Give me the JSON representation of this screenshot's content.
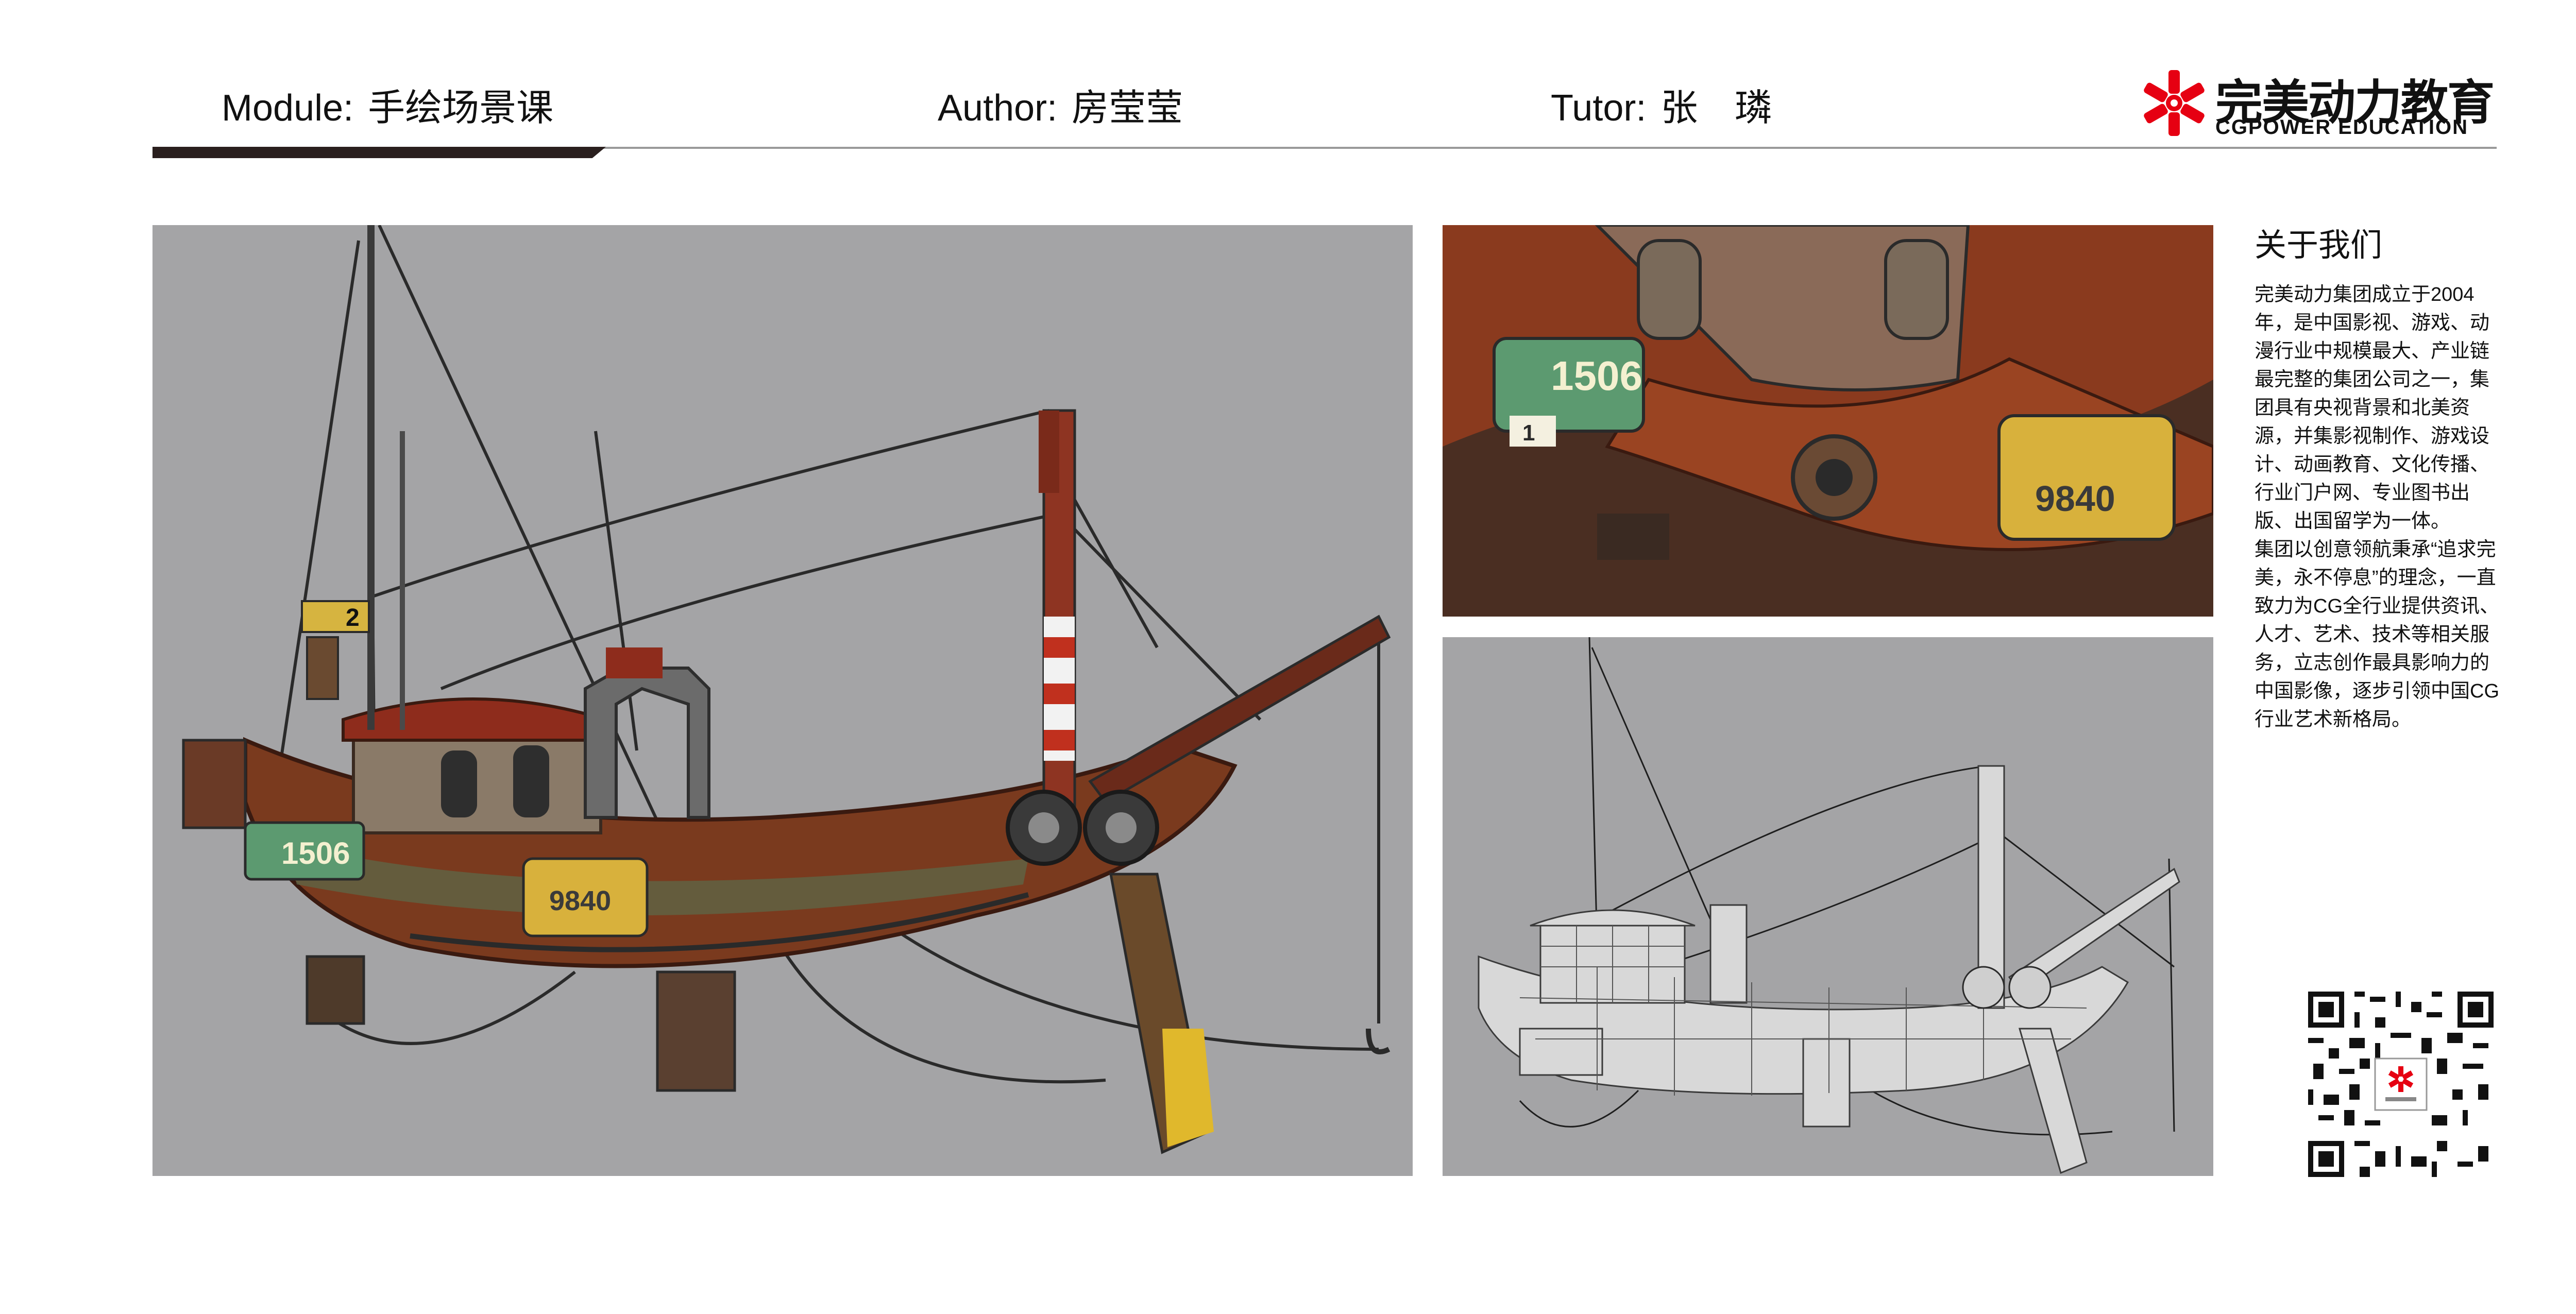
{
  "header": {
    "module_label": "Module:",
    "module_value": "手绘场景课",
    "author_label": "Author:",
    "author_value": "房莹莹",
    "tutor_label": "Tutor:",
    "tutor_value": "张　璘"
  },
  "logo": {
    "cn": "完美动力教育",
    "en": "CGPOWER EDUCATION",
    "accent": "#e60012"
  },
  "artwork": {
    "plate_left": "1506",
    "plate_small": "1",
    "plate_right": "9840",
    "plate_mast": "2",
    "background": "#a4a4a6"
  },
  "about": {
    "title": "关于我们",
    "paragraph1": "完美动力集团成立于2004年，是中国影视、游戏、动漫行业中规模最大、产业链最完整的集团公司之一，集团具有央视背景和北美资源，并集影视制作、游戏设计、动画教育、文化传播、行业门户网、专业图书出版、出国留学为一体。",
    "paragraph2": "集团以创意领航秉承“追求完美，永不停息”的理念，一直致力为CG全行业提供资讯、人才、艺术、技术等相关服务，立志创作最具影响力的中国影像，逐步引领中国CG行业艺术新格局。"
  },
  "icons": {
    "logo": "asterisk-logo-icon",
    "qr": "qr-code-icon"
  }
}
